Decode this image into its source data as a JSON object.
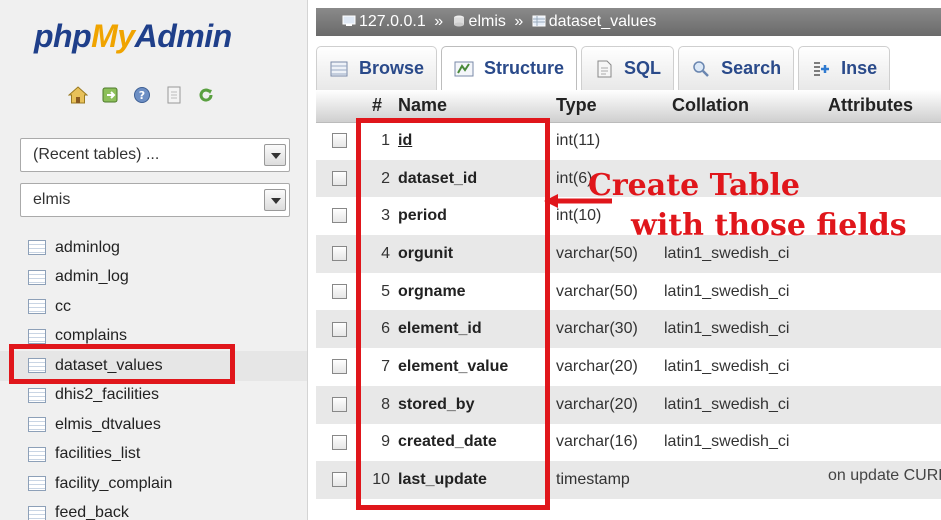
{
  "nav": {
    "logo": {
      "php": "php",
      "my": "My",
      "admin": "Admin"
    },
    "icons": [
      "home-icon",
      "exit-icon",
      "query-window-icon",
      "docs-icon",
      "reload-icon"
    ],
    "recent_tables_select": "(Recent tables) ...",
    "database_select": "elmis",
    "tables": [
      "adminlog",
      "admin_log",
      "cc",
      "complains",
      "dataset_values",
      "dhis2_facilities",
      "elmis_dtvalues",
      "facilities_list",
      "facility_complain",
      "feed_back"
    ],
    "selected_table_index": 4
  },
  "breadcrumb": {
    "server": "127.0.0.1",
    "separator": "»",
    "database": "elmis",
    "table": "dataset_values"
  },
  "tabs": [
    {
      "label": "Browse",
      "icon": "browse-icon"
    },
    {
      "label": "Structure",
      "icon": "structure-icon"
    },
    {
      "label": "SQL",
      "icon": "sql-icon"
    },
    {
      "label": "Search",
      "icon": "search-icon"
    },
    {
      "label": "Inse",
      "icon": "insert-icon"
    }
  ],
  "active_tab": "Structure",
  "structure_table": {
    "headers": {
      "num": "#",
      "name": "Name",
      "type": "Type",
      "collation": "Collation",
      "attributes": "Attributes"
    },
    "rows": [
      {
        "num": "1",
        "name": "id",
        "type": "int(11)",
        "collation": "",
        "attributes": ""
      },
      {
        "num": "2",
        "name": "dataset_id",
        "type": "int(6)",
        "collation": "",
        "attributes": ""
      },
      {
        "num": "3",
        "name": "period",
        "type": "int(10)",
        "collation": "",
        "attributes": ""
      },
      {
        "num": "4",
        "name": "orgunit",
        "type": "varchar(50)",
        "collation": "latin1_swedish_ci",
        "attributes": ""
      },
      {
        "num": "5",
        "name": "orgname",
        "type": "varchar(50)",
        "collation": "latin1_swedish_ci",
        "attributes": ""
      },
      {
        "num": "6",
        "name": "element_id",
        "type": "varchar(30)",
        "collation": "latin1_swedish_ci",
        "attributes": ""
      },
      {
        "num": "7",
        "name": "element_value",
        "type": "varchar(20)",
        "collation": "latin1_swedish_ci",
        "attributes": ""
      },
      {
        "num": "8",
        "name": "stored_by",
        "type": "varchar(20)",
        "collation": "latin1_swedish_ci",
        "attributes": ""
      },
      {
        "num": "9",
        "name": "created_date",
        "type": "varchar(16)",
        "collation": "latin1_swedish_ci",
        "attributes": ""
      },
      {
        "num": "10",
        "name": "last_update",
        "type": "timestamp",
        "collation": "",
        "attributes": "on update CURR"
      }
    ]
  },
  "annotation": {
    "line1": "Create Table",
    "line2": "with those fields",
    "color": "#e0161b"
  },
  "colors": {
    "highlight": "#e0161b",
    "tab_text": "#2a4a8a",
    "logo_blue": "#1f3f8a",
    "logo_orange": "#f0a400"
  }
}
